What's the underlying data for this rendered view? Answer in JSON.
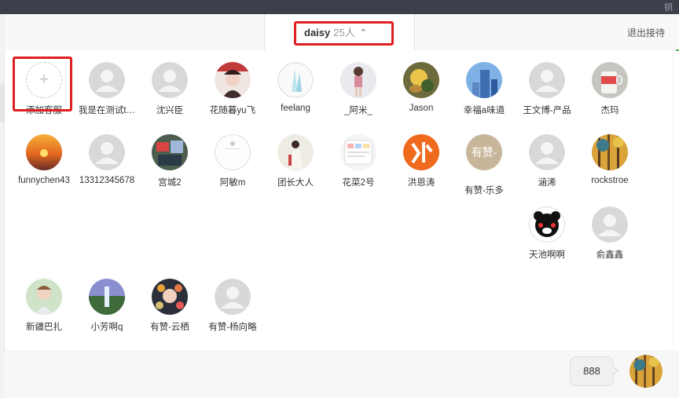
{
  "topbar": {
    "corner_text": "钥"
  },
  "header": {
    "owner_name": "daisy",
    "member_count": "25人",
    "collapse_icon": "chevron-up-icon",
    "exit_label": "退出接待"
  },
  "members": {
    "add": {
      "label": "添加客服",
      "icon": "plus-icon"
    },
    "list": [
      {
        "label": "我是在测试t…",
        "avatar": "default"
      },
      {
        "label": "沈兴臣",
        "avatar": "default"
      },
      {
        "label": "花随暮yu飞",
        "avatar": "photo-girl-red"
      },
      {
        "label": "feelang",
        "avatar": "photo-light"
      },
      {
        "label": "_阿米_",
        "avatar": "photo-girl"
      },
      {
        "label": "Jason",
        "avatar": "photo-food"
      },
      {
        "label": "幸福a味道",
        "avatar": "photo-building"
      },
      {
        "label": "王文博-产品",
        "avatar": "default"
      },
      {
        "label": "杰玛",
        "avatar": "photo-cup"
      },
      {
        "label": "funnychen43",
        "avatar": "photo-sunset"
      },
      {
        "label": "13312345678",
        "avatar": "default"
      },
      {
        "label": "宫城2",
        "avatar": "photo-desk"
      },
      {
        "label": "阿敏m",
        "avatar": "photo-white"
      },
      {
        "label": "团长大人",
        "avatar": "photo-woman"
      },
      {
        "label": "花菜2号",
        "avatar": "photo-screen"
      },
      {
        "label": "洪恩涛",
        "avatar": "photo-orange"
      },
      {
        "label": "有赞-乐多",
        "avatar": "text",
        "avatar_text": "有赞-"
      },
      {
        "label": "涵浠",
        "avatar": "default"
      },
      {
        "label": "rockstroe",
        "avatar": "photo-forest"
      },
      {
        "label": "天池啊啊",
        "avatar": "photo-bear"
      },
      {
        "label": "俞鑫鑫",
        "avatar": "default"
      },
      {
        "label": "新疆巴扎",
        "avatar": "photo-kid"
      },
      {
        "label": "小芳啊q",
        "avatar": "photo-waterfall"
      },
      {
        "label": "有赞-云栖",
        "avatar": "photo-flowers"
      },
      {
        "label": "有赞-杨向略",
        "avatar": "default"
      }
    ]
  },
  "chat": {
    "message": "888",
    "self_avatar": "photo-forest"
  },
  "colors": {
    "highlight": "#e02020",
    "accent_green": "#4caf50",
    "topbar": "#3d3f4a"
  }
}
